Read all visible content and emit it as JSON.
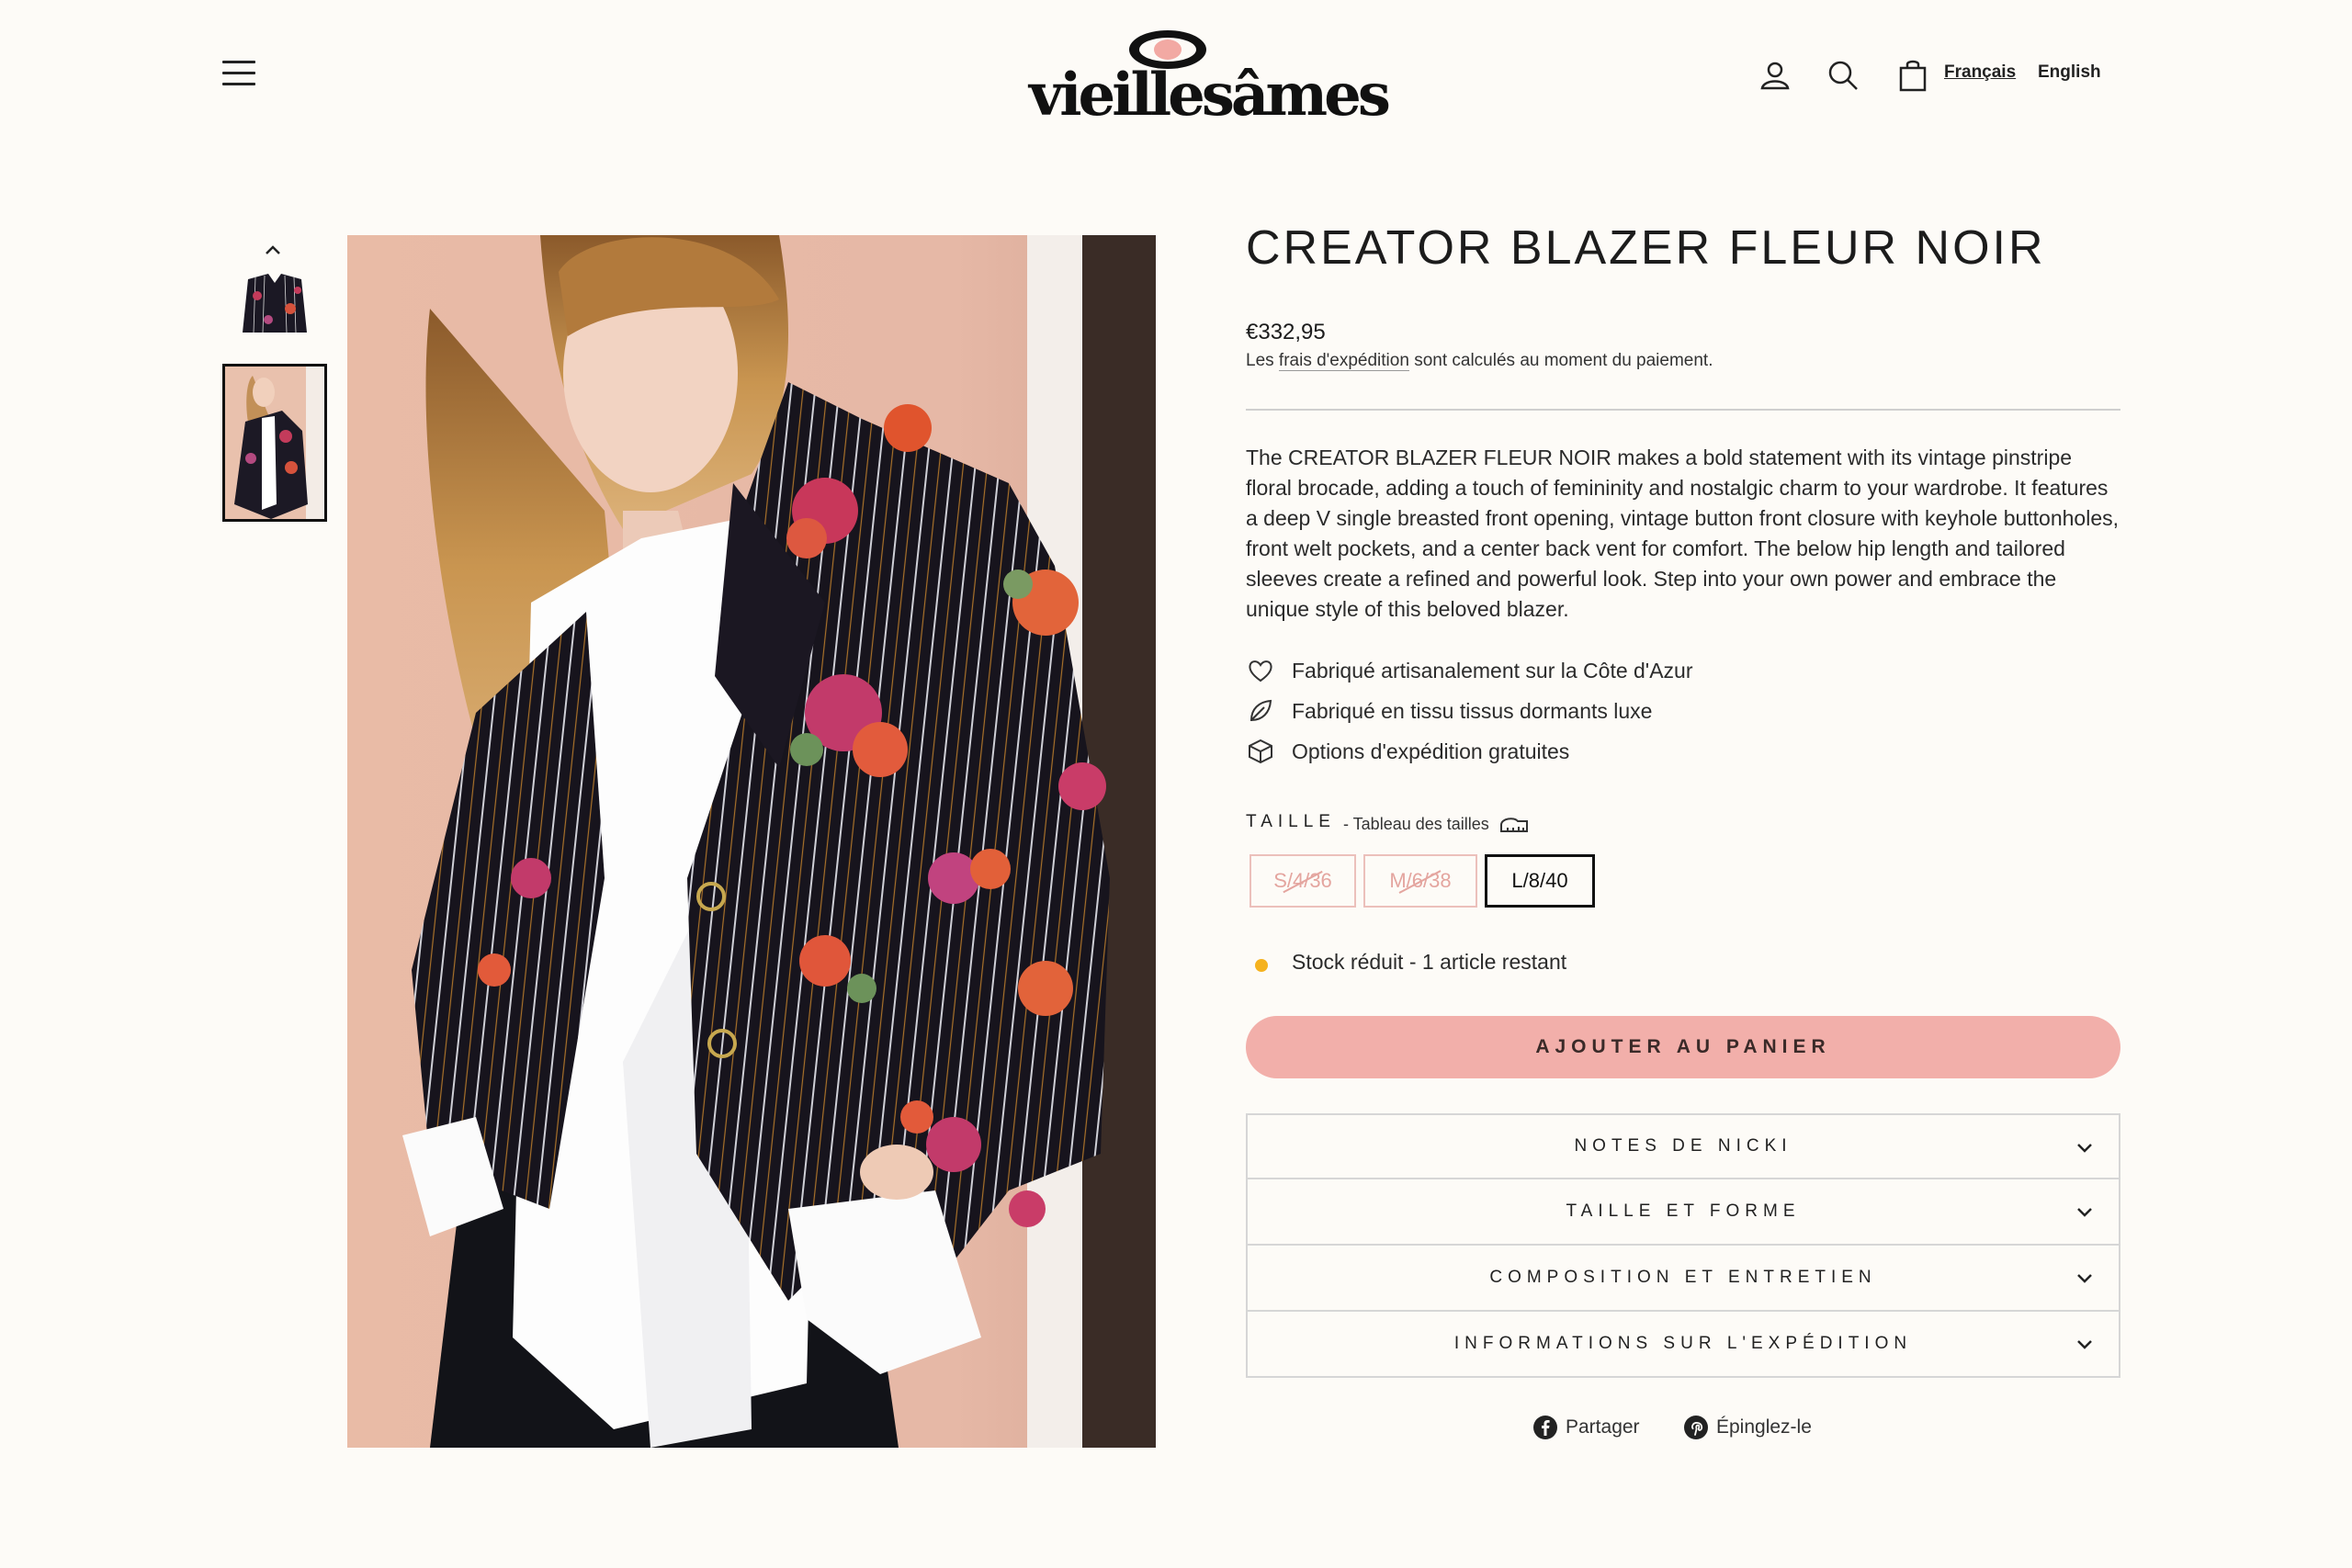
{
  "header": {
    "logo_text": "vieillesâmes",
    "lang_fr": "Français",
    "lang_en": "English"
  },
  "product": {
    "title": "CREATOR BLAZER FLEUR NOIR",
    "price": "€332,95",
    "shipping_prefix": "Les ",
    "shipping_link": "frais d'expédition",
    "shipping_suffix": " sont calculés au moment du paiement.",
    "description": "The CREATOR BLAZER FLEUR NOIR makes a bold statement with its vintage pinstripe floral brocade, adding a touch of femininity and nostalgic charm to your wardrobe. It features a deep V single breasted front opening, vintage button front closure with keyhole buttonholes, front welt pockets, and a center back vent for comfort. The below hip length and tailored sleeves create a refined and powerful look. Step into your own power and embrace the unique style of this beloved blazer.",
    "features": [
      {
        "icon": "heart-icon",
        "text": "Fabriqué artisanalement sur la Côte d'Azur"
      },
      {
        "icon": "leaf-icon",
        "text": "Fabriqué en tissu tissus dormants luxe"
      },
      {
        "icon": "box-icon",
        "text": "Options d'expédition gratuites"
      }
    ],
    "size_label": "TAILLE",
    "size_chart_link": "- Tableau des tailles",
    "sizes": [
      {
        "label": "S/4/36",
        "available": false
      },
      {
        "label": "M/6/38",
        "available": false
      },
      {
        "label": "L/8/40",
        "available": true,
        "selected": true
      }
    ],
    "stock_text": "Stock réduit - 1 article restant",
    "stock_color": "#f5b21e",
    "add_to_cart": "AJOUTER AU PANIER",
    "accent_color": "#f2afaa",
    "accordions": [
      "NOTES DE NICKI",
      "TAILLE ET FORME",
      "COMPOSITION ET ENTRETIEN",
      "INFORMATIONS SUR L'EXPÉDITION"
    ],
    "share_label": "Partager",
    "pin_label": "Épinglez-le"
  }
}
